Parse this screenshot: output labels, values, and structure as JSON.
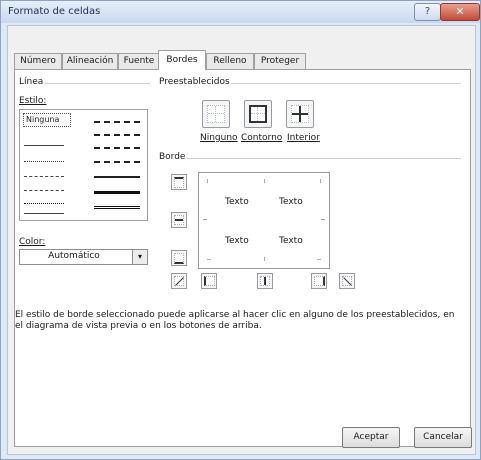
{
  "window": {
    "title": "Formato de celdas",
    "help_label": "?",
    "close_label": "✕"
  },
  "tabs": [
    {
      "label": "Número"
    },
    {
      "label": "Alineación"
    },
    {
      "label": "Fuente"
    },
    {
      "label": "Bordes",
      "active": true
    },
    {
      "label": "Relleno"
    },
    {
      "label": "Proteger"
    }
  ],
  "line": {
    "group_label": "Línea",
    "style_label": "Estilo:",
    "none_label": "Ninguna",
    "color_label": "Color:",
    "color_value": "Automático",
    "dropdown_icon": "▾"
  },
  "presets": {
    "group_label": "Preestablecidos",
    "items": [
      {
        "label": "Ninguno"
      },
      {
        "label": "Contorno"
      },
      {
        "label": "Interior"
      }
    ]
  },
  "border": {
    "group_label": "Borde",
    "preview_texts": [
      "Texto",
      "Texto",
      "Texto",
      "Texto"
    ]
  },
  "description": "El estilo de borde seleccionado puede aplicarse al hacer clic en alguno de los preestablecidos, en el diagrama de vista previa o en los botones de arriba.",
  "buttons": {
    "ok": "Aceptar",
    "cancel": "Cancelar"
  },
  "colors": {
    "title_bar": "#c9d9ef",
    "close_button": "#c44a33",
    "preset_border": "#9a9a9a"
  }
}
